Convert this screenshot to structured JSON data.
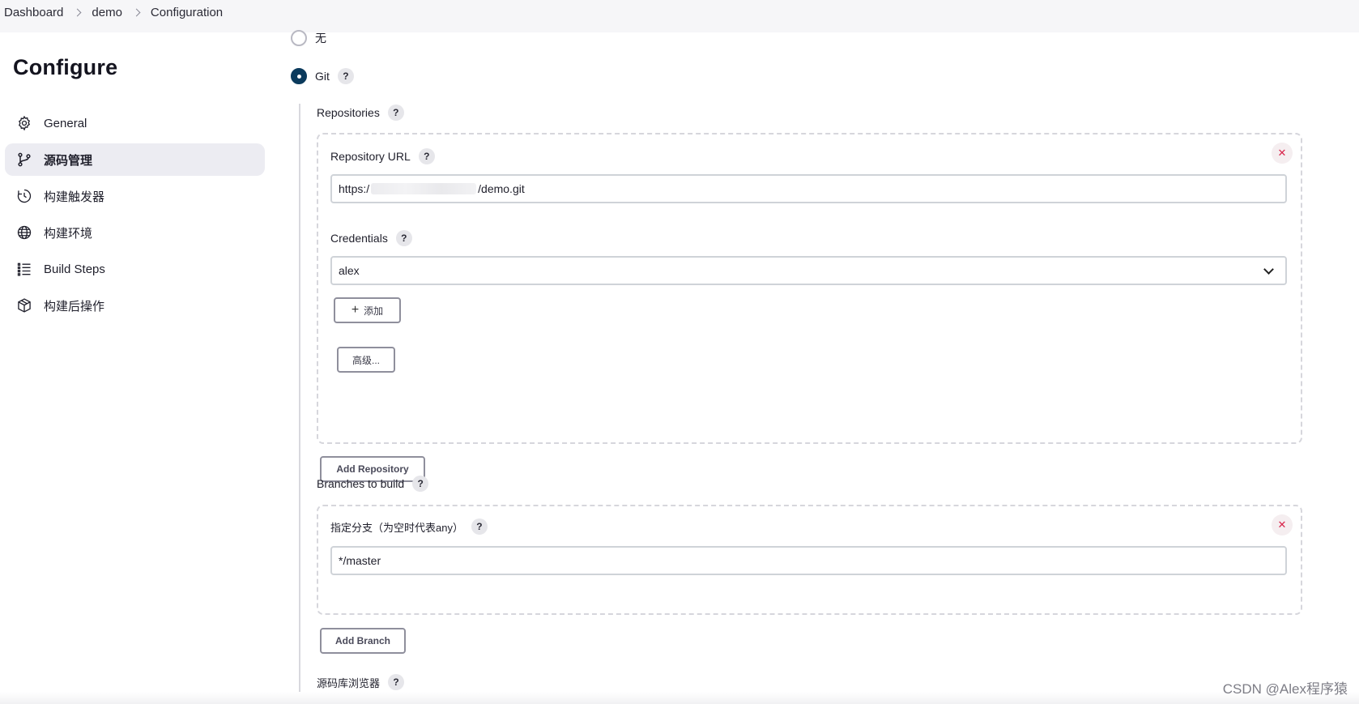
{
  "breadcrumb": [
    "Dashboard",
    "demo",
    "Configuration"
  ],
  "sidebar": {
    "title": "Configure",
    "items": [
      {
        "label": "General",
        "icon": "gear-icon"
      },
      {
        "label": "源码管理",
        "icon": "branch-icon",
        "active": true
      },
      {
        "label": "构建触发器",
        "icon": "clock-icon"
      },
      {
        "label": "构建环境",
        "icon": "globe-icon"
      },
      {
        "label": "Build Steps",
        "icon": "list-icon"
      },
      {
        "label": "构建后操作",
        "icon": "package-icon"
      }
    ]
  },
  "scm": {
    "option_none": "无",
    "option_git": "Git",
    "selected": "Git",
    "help_glyph": "?",
    "repositories_label": "Repositories",
    "repo_url_label": "Repository URL",
    "repo_url_prefix": "https:/",
    "repo_url_suffix": "/demo.git",
    "credentials_label": "Credentials",
    "credentials_value": "alex",
    "add_button": "添加",
    "advanced_button": "高级...",
    "add_repository_button": "Add Repository",
    "branches_label": "Branches to build",
    "branch_specifier_label": "指定分支（为空时代表any）",
    "branch_value": "*/master",
    "add_branch_button": "Add Branch",
    "repo_browser_label": "源码库浏览器",
    "remove_glyph": "✕"
  },
  "watermark": "CSDN @Alex程序猿",
  "colors": {
    "accent": "#0b3a5c",
    "remove": "#d8254b",
    "active_nav_bg": "#ececf2"
  }
}
